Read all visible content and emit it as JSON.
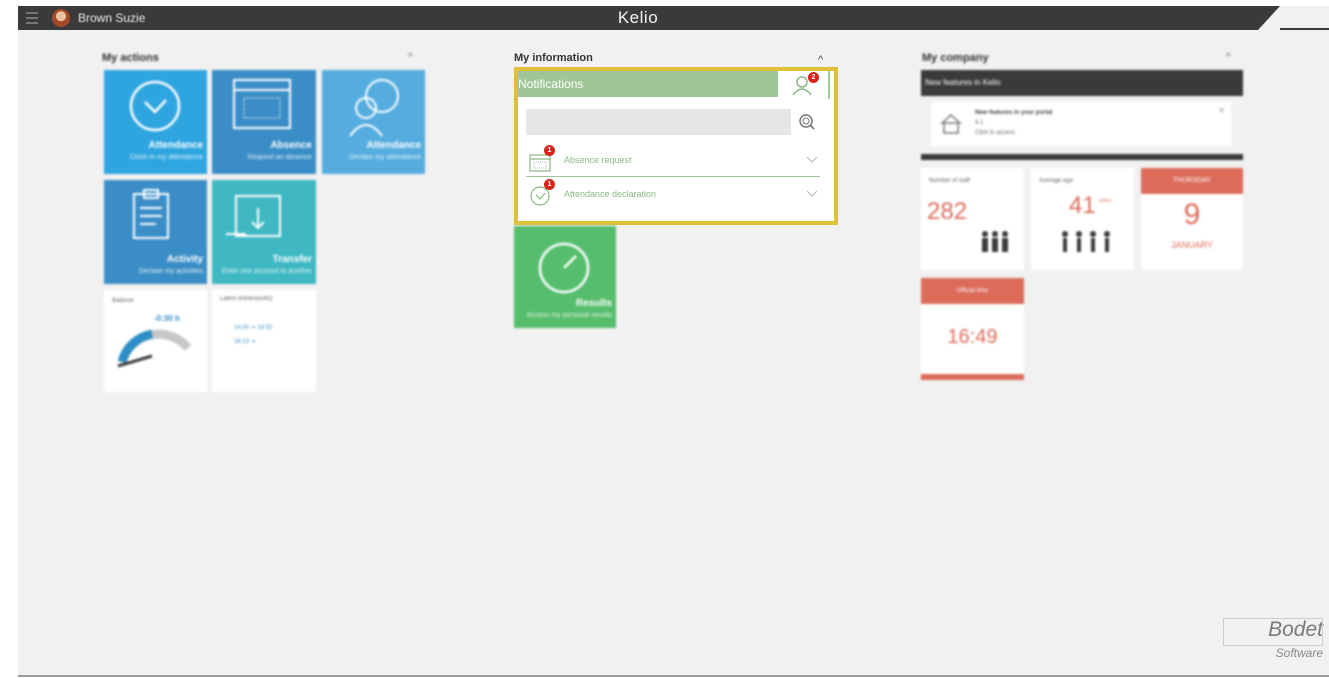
{
  "topbar": {
    "user_name": "Brown Suzie",
    "brand": "Kelio"
  },
  "columns": {
    "actions_title": "My actions",
    "information_title": "My information",
    "company_title": "My company"
  },
  "actions": {
    "tiles": [
      {
        "title": "Attendance",
        "subtitle": "Clock-in my attendance",
        "color": "#2ea5df"
      },
      {
        "title": "Absence",
        "subtitle": "Request an absence",
        "color": "#3a8dc6"
      },
      {
        "title": "Attendance",
        "subtitle": "Declare my attendance",
        "color": "#55acdf"
      },
      {
        "title": "Activity",
        "subtitle": "Declare my activities",
        "color": "#3a8dc6"
      },
      {
        "title": "Transfer",
        "subtitle": "Enter one account to another",
        "color": "#3fb8c4"
      }
    ],
    "balance": {
      "label": "Balance",
      "value": "-0:30 h"
    },
    "latest_entries": {
      "label": "Latest entries(exits)",
      "line1": "14:00 ➞ 14:32",
      "line2": "16:13 ➞"
    }
  },
  "notifications": {
    "title": "Notifications",
    "user_badge": "2",
    "search_placeholder": "",
    "items": [
      {
        "label": "Absence request",
        "badge": "1"
      },
      {
        "label": "Attendance declaration",
        "badge": "1"
      }
    ]
  },
  "results": {
    "title": "Results",
    "subtitle": "Access my personal results",
    "color": "#55bd6c"
  },
  "company": {
    "news_header": "New features in Kelio",
    "news_title": "New features in your portal",
    "news_version": "4.1",
    "news_link": "Click to access",
    "staff_label": "Number of staff",
    "staff_value": "282",
    "age_label": "Average age",
    "age_value": "41",
    "age_unit": "years",
    "day_name": "THURSDAY",
    "day_number": "9",
    "month": "JANUARY",
    "official_time_label": "Official time",
    "official_time": "16:49",
    "accent_color": "#dc6b5a"
  },
  "footer": {
    "logo_line1": "Bodet",
    "logo_line2": "Software"
  }
}
